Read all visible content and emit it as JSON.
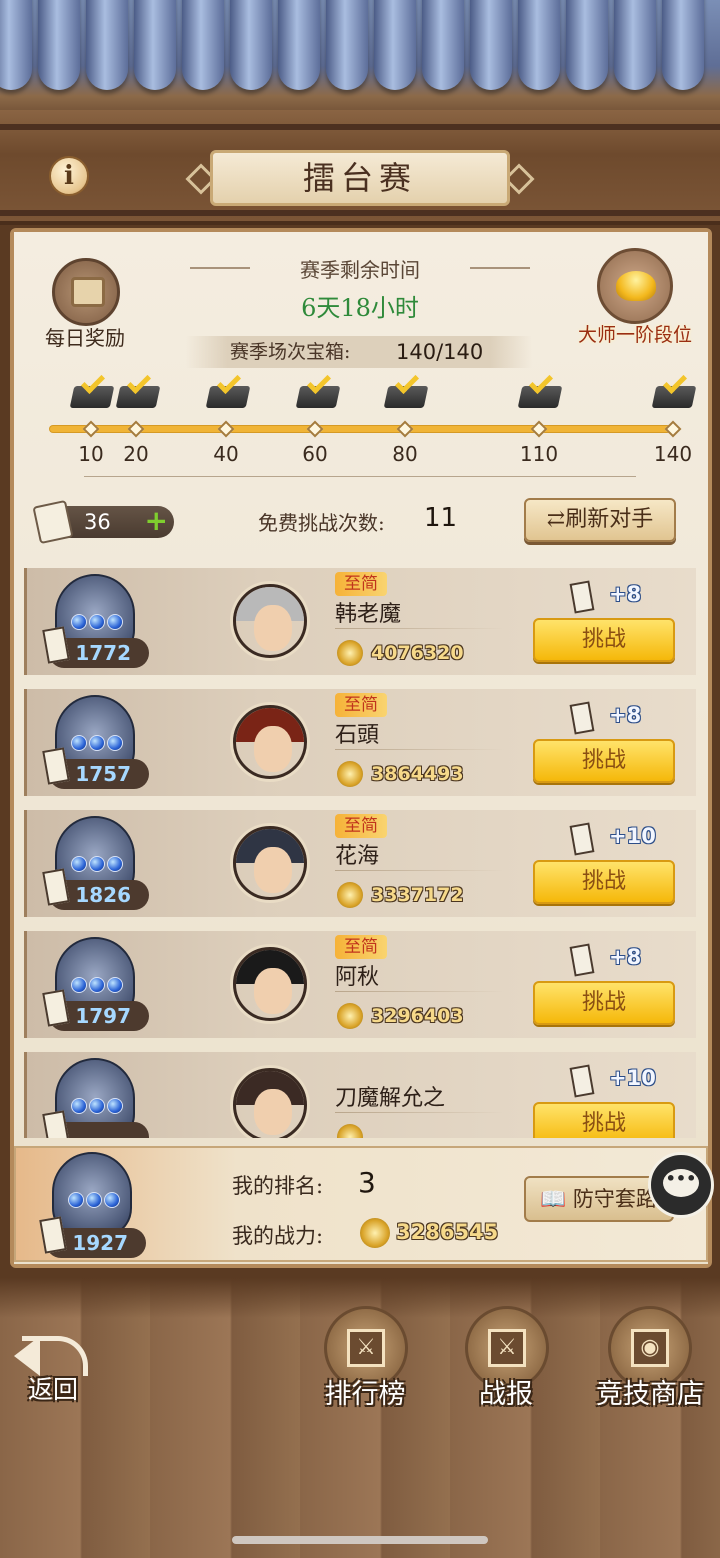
{
  "header": {
    "title": "擂台赛",
    "info_icon": "i"
  },
  "daily_reward": {
    "label": "每日奖励",
    "icon": "chest-icon"
  },
  "season": {
    "remaining_label": "赛季剩余时间",
    "remaining_value": "6天18小时",
    "chest_label": "赛季场次宝箱:",
    "chest_value": "140/140"
  },
  "rank_tier": {
    "label": "大师一阶段位",
    "icon": "gold-ingot-icon"
  },
  "milestones": [
    "10",
    "20",
    "40",
    "60",
    "80",
    "110",
    "140"
  ],
  "milestone_progress": 1.0,
  "tokens": {
    "count": "36",
    "plus": "+"
  },
  "free_challenges": {
    "label": "免费挑战次数:",
    "count": "11"
  },
  "refresh_button": "刷新对手",
  "opponents": [
    {
      "score": "1772",
      "badge": "至简",
      "name": "韩老魔",
      "power": "4076320",
      "reward": "+8",
      "button": "挑战",
      "hair": "#b9b9b9"
    },
    {
      "score": "1757",
      "badge": "至简",
      "name": "石頭",
      "power": "3864493",
      "reward": "+8",
      "button": "挑战",
      "hair": "#7a2416"
    },
    {
      "score": "1826",
      "badge": "至简",
      "name": "花海",
      "power": "3337172",
      "reward": "+10",
      "button": "挑战",
      "hair": "#2f3544"
    },
    {
      "score": "1797",
      "badge": "至简",
      "name": "阿秋",
      "power": "3296403",
      "reward": "+8",
      "button": "挑战",
      "hair": "#1a1a1a"
    },
    {
      "score": "",
      "badge": "",
      "name": "刀魔解允之",
      "power": "",
      "reward": "+10",
      "button": "挑战",
      "hair": "#3b2a24"
    }
  ],
  "me": {
    "score": "1927",
    "rank_label": "我的排名:",
    "rank_value": "3",
    "power_label": "我的战力:",
    "power_value": "3286545",
    "defense_button": "防守套路"
  },
  "nav": {
    "back": "返回",
    "leaderboard": "排行榜",
    "battle_report": "战报",
    "arena_shop": "竞技商店"
  },
  "colors": {
    "accent_gold": "#f5b80a",
    "time_green": "#2f8a3a",
    "rank_red": "#9a2e12"
  }
}
